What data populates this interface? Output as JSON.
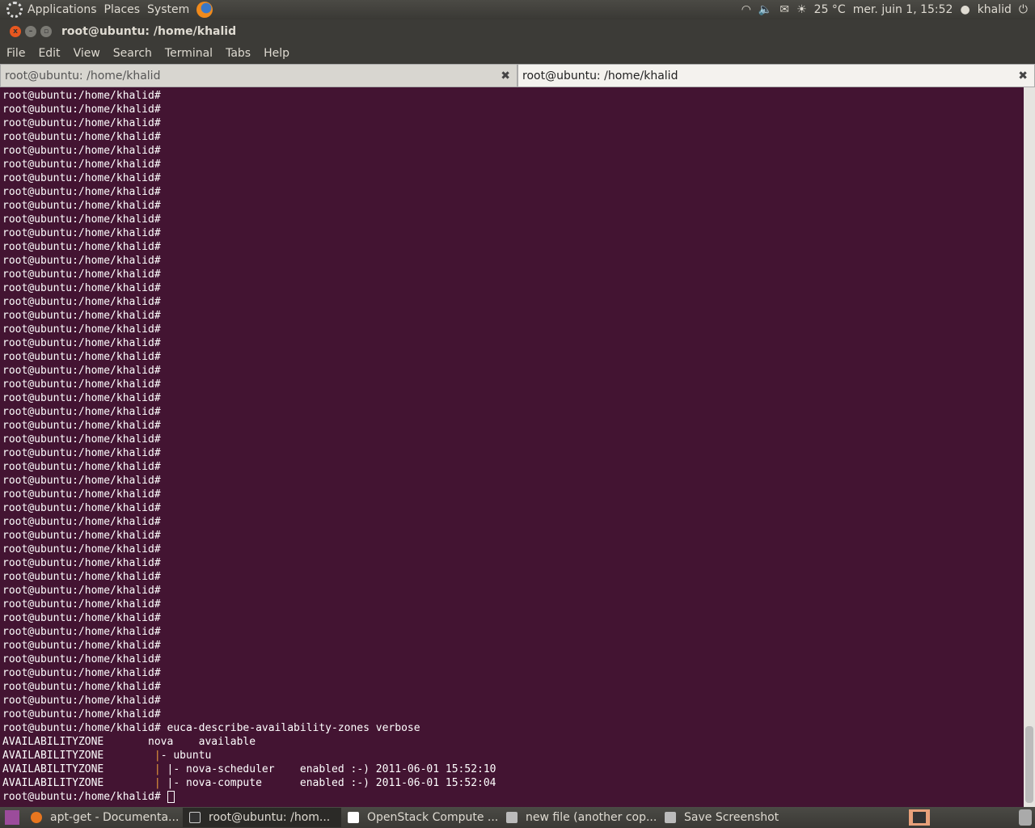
{
  "top_panel": {
    "menus": [
      "Applications",
      "Places",
      "System"
    ],
    "temperature": "25 °C",
    "datetime": "mer. juin 1, 15:52",
    "user": "khalid"
  },
  "window": {
    "title": "root@ubuntu: /home/khalid"
  },
  "menubar": [
    "File",
    "Edit",
    "View",
    "Search",
    "Terminal",
    "Tabs",
    "Help"
  ],
  "tabs": [
    {
      "label": "root@ubuntu: /home/khalid"
    },
    {
      "label": "root@ubuntu: /home/khalid"
    }
  ],
  "terminal": {
    "prompt": "root@ubuntu:/home/khalid#",
    "empty_prompt_count": 46,
    "command": "euca-describe-availability-zones verbose",
    "output": [
      {
        "c1": "AVAILABILITYZONE",
        "c2": "       nova    available"
      },
      {
        "c1": "AVAILABILITYZONE",
        "bar": "|",
        "c2": "- ubuntu"
      },
      {
        "c1": "AVAILABILITYZONE",
        "bar": "|",
        "c2": " |- nova-scheduler    enabled :-) 2011-06-01 15:52:10"
      },
      {
        "c1": "AVAILABILITYZONE",
        "bar": "|",
        "c2": " |- nova-compute      enabled :-) 2011-06-01 15:52:04"
      }
    ]
  },
  "taskbar": [
    "apt-get - Documenta...",
    "root@ubuntu: /hom...",
    "OpenStack Compute ...",
    "new file (another cop...",
    "Save Screenshot"
  ]
}
